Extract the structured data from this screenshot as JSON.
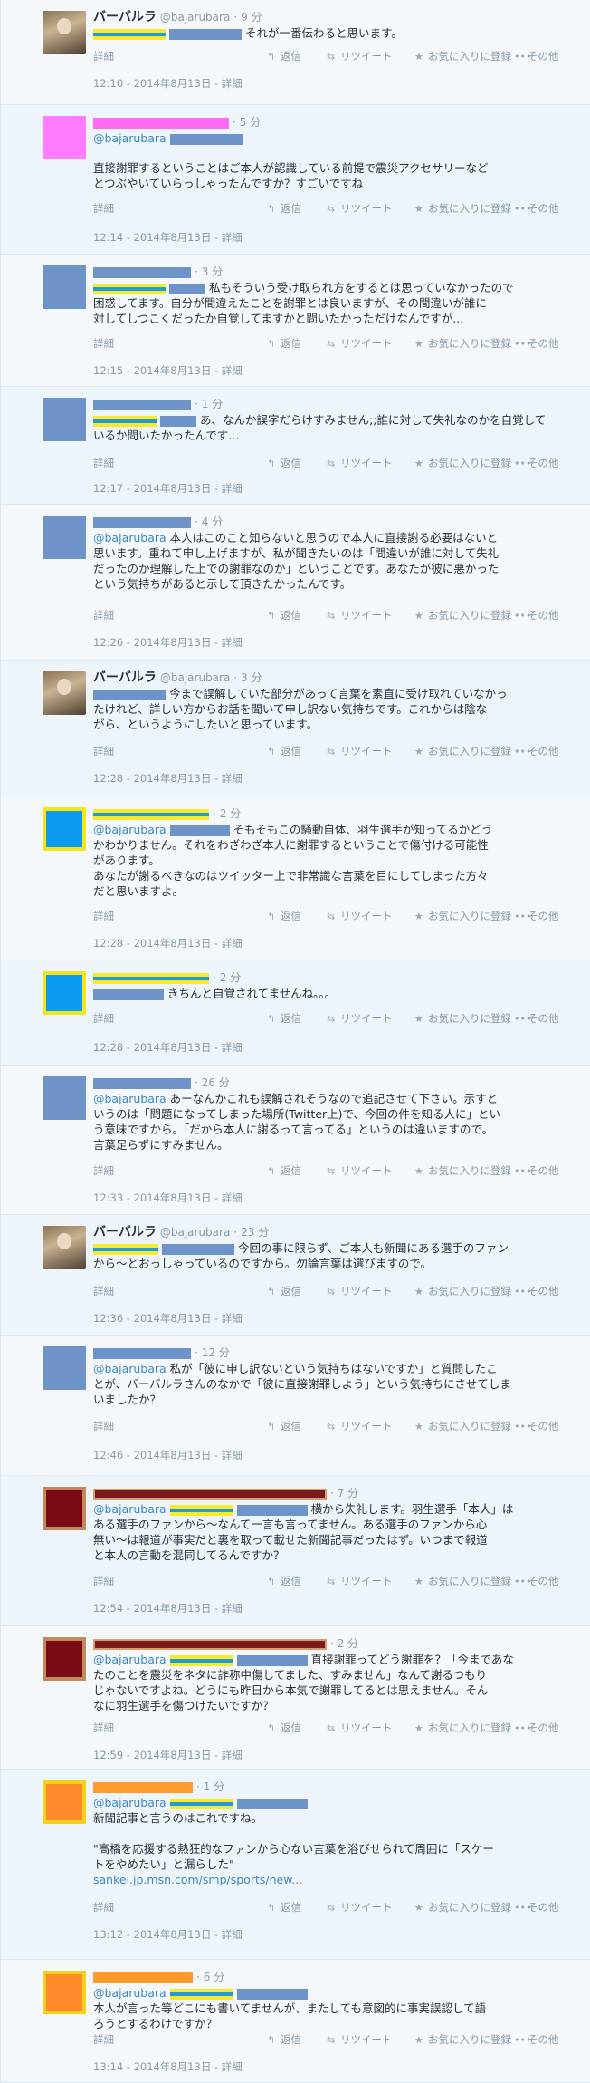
{
  "actions": {
    "detail": "詳細",
    "reply": "返信",
    "retweet": "リツイート",
    "favorite": "お気に入りに登録",
    "more": "その他",
    "detail_sep": " - "
  },
  "colors": {
    "link": "#3b88c3",
    "muted": "#8899a6",
    "background": "#f5f8fa"
  },
  "tweets": [
    {
      "name": "バーバルラ",
      "handle": "@bajarubara",
      "dot": "·",
      "age": "9 分",
      "lines": [
        "それが一番伝わると思います。"
      ],
      "time": "12:10 - 2014年8月13日"
    },
    {
      "dot": "·",
      "age": "5 分",
      "mention": "@bajarubara",
      "lines": [
        "直接謝罪するということはご本人が認識している前提で震災アクセサリーなど",
        "とつぶやいていらっしゃったんですか？すごいですね"
      ],
      "time": "12:14 - 2014年8月13日"
    },
    {
      "dot": "·",
      "age": "3 分",
      "lines": [
        "私もそういう受け取られ方をするとは思っていなかったので",
        "困惑してます。自分が間違えたことを謝罪とは良いますが、その間違いが誰に",
        "対してしつこくだったか自覚してますかと問いたかっただけなんですが..."
      ],
      "time": "12:15 - 2014年8月13日"
    },
    {
      "dot": "·",
      "age": "1 分",
      "lines": [
        "あ、なんか誤字だらけすみません;;誰に対して失礼なのかを自覚して",
        "いるか問いたかったんです..."
      ],
      "time": "12:17 - 2014年8月13日"
    },
    {
      "dot": "·",
      "age": "4 分",
      "mention": "@bajarubara",
      "lines": [
        "本人はこのこと知らないと思うので本人に直接謝る必要はないと",
        "思います。重ねて申し上げますが、私が聞きたいのは「間違いが誰に対して失礼",
        "だったのか理解した上での謝罪なのか」ということです。あなたが彼に悪かった",
        "という気持ちがあると示して頂きたかったんです。"
      ],
      "time": "12:26 - 2014年8月13日"
    },
    {
      "name": "バーバルラ",
      "handle": "@bajarubara",
      "dot": "·",
      "age": "3 分",
      "lines": [
        "今まで誤解していた部分があって言葉を素直に受け取れていなかっ",
        "たけれど、詳しい方からお話を聞いて申し訳ない気持ちです。これからは陰な",
        "がら、というようにしたいと思っています。"
      ],
      "time": "12:28 - 2014年8月13日"
    },
    {
      "dot": "·",
      "age": "2 分",
      "mention": "@bajarubara",
      "lines": [
        "そもそもこの騒動自体、羽生選手が知ってるかどう",
        "かわかりません。それをわざわざ本人に謝罪するということで傷付ける可能性",
        "があります。",
        "あなたが謝るべきなのはツイッター上で非常識な言葉を目にしてしまった方々",
        "だと思いますよ。"
      ],
      "time": "12:28 - 2014年8月13日"
    },
    {
      "dot": "·",
      "age": "2 分",
      "lines": [
        "きちんと自覚されてませんね。。。"
      ],
      "time": "12:28 - 2014年8月13日"
    },
    {
      "dot": "·",
      "age": "26 分",
      "mention": "@bajarubara",
      "lines": [
        "あーなんかこれも誤解されそうなので追記させて下さい。示すと",
        "いうのは「問題になってしまった場所(Twitter上)で、今回の件を知る人に」とい",
        "う意味ですから。「だから本人に謝るって言ってる」というのは違いますので。",
        "言葉足らずにすみません。"
      ],
      "time": "12:33 - 2014年8月13日"
    },
    {
      "name": "バーバルラ",
      "handle": "@bajarubara",
      "dot": "·",
      "age": "23 分",
      "lines": [
        "今回の事に限らず、ご本人も新聞にある選手のファン",
        "から〜とおっしゃっているのですから。勿論言葉は選びますので。"
      ],
      "time": "12:36 - 2014年8月13日"
    },
    {
      "dot": "·",
      "age": "12 分",
      "mention": "@bajarubara",
      "lines": [
        "私が「彼に申し訳ないという気持ちはないですか」と質問したこ",
        "とが、バーバルラさんのなかで「彼に直接謝罪しよう」という気持ちにさせてしま",
        "いましたか？"
      ],
      "time": "12:46 - 2014年8月13日"
    },
    {
      "dot": "·",
      "age": "7 分",
      "mention": "@bajarubara",
      "lines": [
        "横から失礼します。羽生選手「本人」は",
        "ある選手のファンから〜なんて一言も言ってません。ある選手のファンから心",
        "無い〜は報道が事実だと裏を取って載せた新聞記事だったはず。いつまで報道",
        "と本人の言動を混同してるんですか？"
      ],
      "time": "12:54 - 2014年8月13日"
    },
    {
      "dot": "·",
      "age": "2 分",
      "mention": "@bajarubara",
      "lines": [
        "直接謝罪ってどう謝罪を？「今まであな",
        "たのことを震災をネタに詐称中傷してました、すみません」なんて謝るつもり",
        "じゃないですよね。どうにも昨日から本気で謝罪してるとは思えません。そん",
        "なに羽生選手を傷つけたいですか？"
      ],
      "time": "12:59 - 2014年8月13日"
    },
    {
      "dot": "·",
      "age": "1 分",
      "mention": "@bajarubara",
      "lines": [
        "新聞記事と言うのはこれですね。",
        "",
        "\"高橋を応援する熱狂的なファンから心ない言葉を浴びせられて周囲に「スケー",
        "トをやめたい」と漏らした\""
      ],
      "link": "sankei.jp.msn.com/smp/sports/new...",
      "time": "13:12 - 2014年8月13日"
    },
    {
      "dot": "·",
      "age": "6 分",
      "mention": "@bajarubara",
      "lines": [
        "本人が言った等どこにも書いてませんが、またしても意図的に事実誤認して語",
        "ろうとするわけですか？"
      ],
      "time": "13:14 - 2014年8月13日"
    }
  ]
}
